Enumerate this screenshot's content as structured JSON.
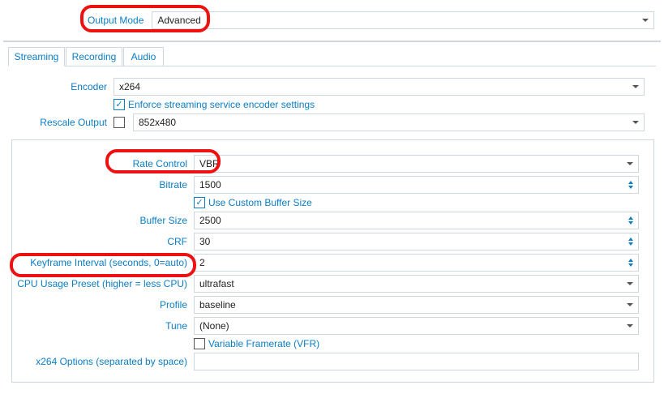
{
  "top": {
    "label": "Output Mode",
    "value": "Advanced"
  },
  "tabs": {
    "streaming": "Streaming",
    "recording": "Recording",
    "audio": "Audio"
  },
  "encoder": {
    "label": "Encoder",
    "value": "x264"
  },
  "enforce": {
    "label": "Enforce streaming service encoder settings",
    "checked": true
  },
  "rescale": {
    "label": "Rescale Output",
    "checked": false,
    "value": "852x480"
  },
  "rate_control": {
    "label": "Rate Control",
    "value": "VBR"
  },
  "bitrate": {
    "label": "Bitrate",
    "value": "1500"
  },
  "custom_buf": {
    "label": "Use Custom Buffer Size",
    "checked": true
  },
  "buffer_size": {
    "label": "Buffer Size",
    "value": "2500"
  },
  "crf": {
    "label": "CRF",
    "value": "30"
  },
  "keyframe": {
    "label": "Keyframe Interval (seconds, 0=auto)",
    "value": "2"
  },
  "cpu_preset": {
    "label": "CPU Usage Preset (higher = less CPU)",
    "value": "ultrafast"
  },
  "profile": {
    "label": "Profile",
    "value": "baseline"
  },
  "tune": {
    "label": "Tune",
    "value": "(None)"
  },
  "vfr": {
    "label": "Variable Framerate (VFR)",
    "checked": false
  },
  "x264_opts": {
    "label": "x264 Options (separated by space)",
    "value": ""
  }
}
